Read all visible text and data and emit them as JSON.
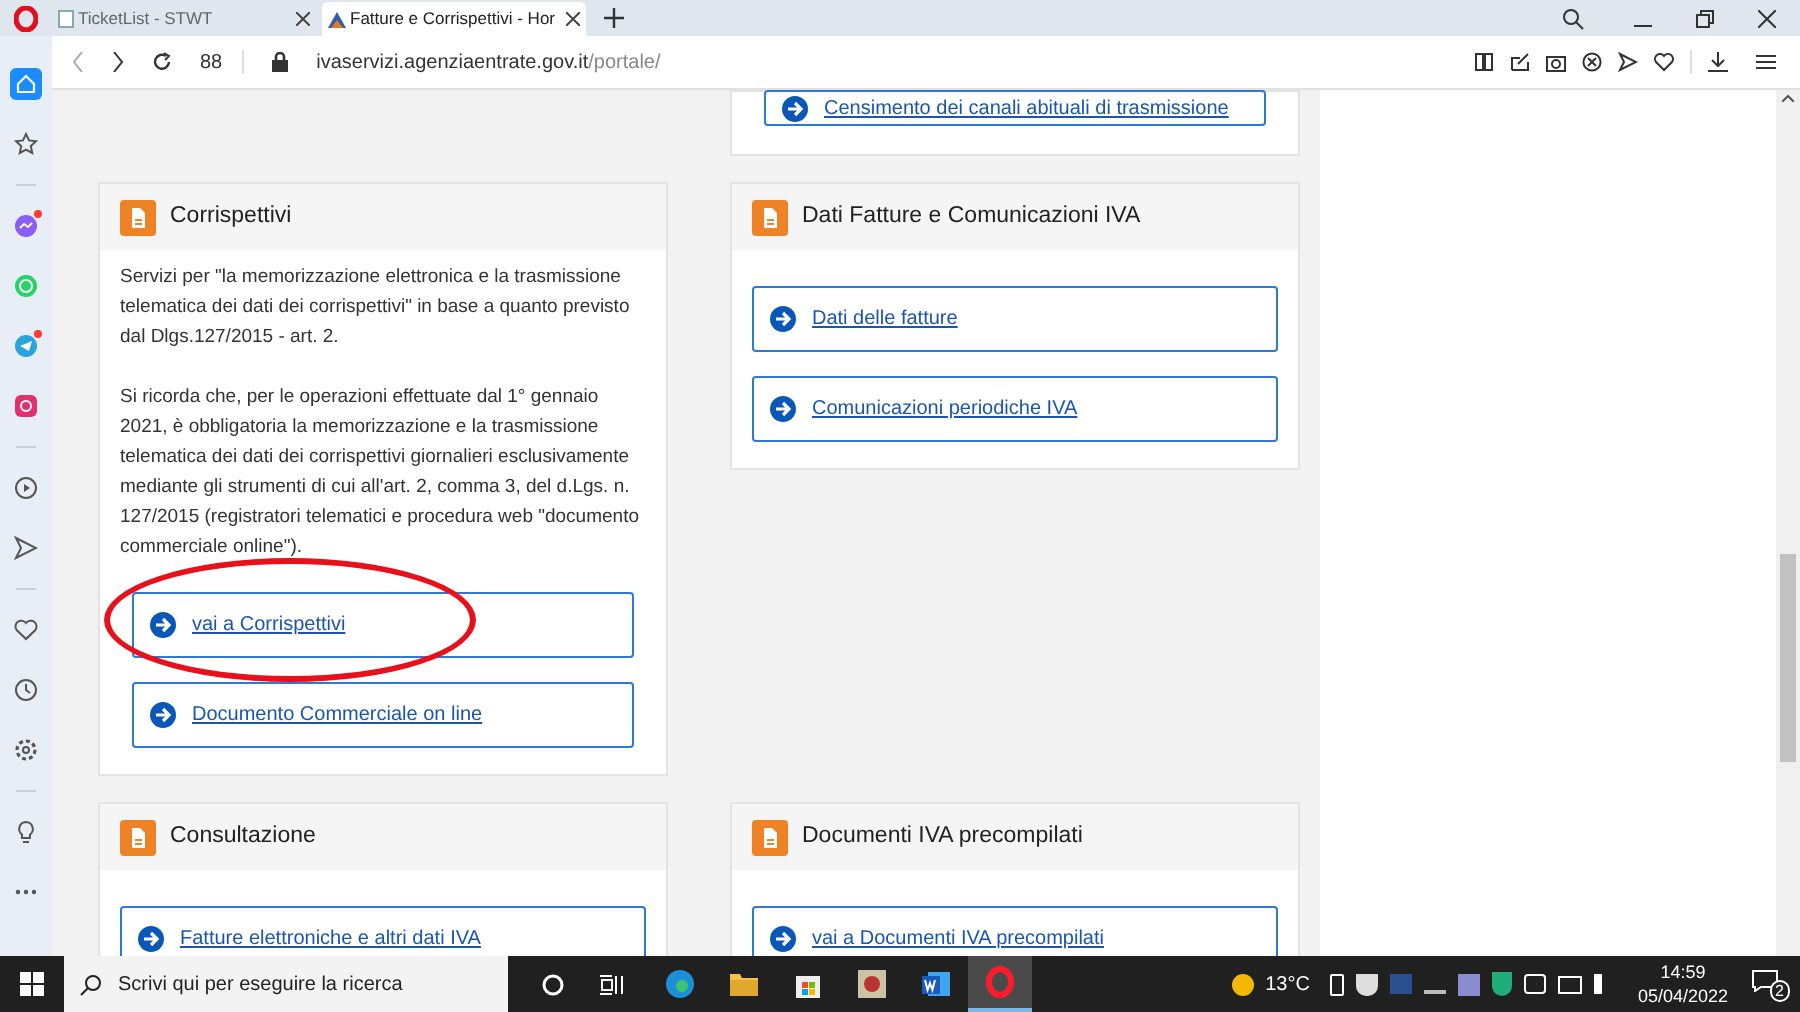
{
  "browser": {
    "tabs": [
      {
        "title": "TicketList - STWT",
        "selected": false
      },
      {
        "title": "Fatture e Corrispettivi - Hor",
        "selected": true
      }
    ],
    "speed_dial": "88",
    "url_domain": "ivaservizi.agenziaentrate.gov.it",
    "url_path": "/portale/"
  },
  "sidebar": {
    "items": [
      {
        "kind": "home",
        "selected": true,
        "badge": false
      },
      {
        "kind": "star",
        "selected": false,
        "badge": false
      },
      {
        "kind": "messenger",
        "selected": false,
        "badge": true
      },
      {
        "kind": "whatsapp",
        "selected": false,
        "badge": false
      },
      {
        "kind": "telegram",
        "selected": false,
        "badge": true
      },
      {
        "kind": "instagram",
        "selected": false,
        "badge": false
      },
      {
        "kind": "player",
        "selected": false,
        "badge": false
      },
      {
        "kind": "send",
        "selected": false,
        "badge": false
      },
      {
        "kind": "heart",
        "selected": false,
        "badge": false
      },
      {
        "kind": "clock",
        "selected": false,
        "badge": false
      },
      {
        "kind": "settings",
        "selected": false,
        "badge": false
      },
      {
        "kind": "bulb",
        "selected": false,
        "badge": false
      },
      {
        "kind": "more",
        "selected": false,
        "badge": false
      }
    ]
  },
  "cards": [
    {
      "links": [
        {
          "label": "Censimento dei canali abituali di trasmissione",
          "circled": false
        }
      ]
    },
    {
      "title": "Corrispettivi",
      "paragraphs": [
        "Servizi per \"la memorizzazione elettronica e la trasmissione telematica dei dati dei corrispettivi\" in base a quanto previsto dal Dlgs.127/2015 - art. 2.",
        "Si ricorda che, per le operazioni effettuate dal 1° gennaio 2021, è obbligatoria la memorizzazione e la trasmissione telematica dei dati dei corrispettivi giornalieri esclusivamente mediante gli strumenti di cui all'art. 2, comma 3, del d.Lgs. n. 127/2015 (registratori telematici e procedura web \"documento commerciale online\")."
      ],
      "links": [
        {
          "label": "vai a Corrispettivi",
          "circled": true
        },
        {
          "label": "Documento Commerciale on line",
          "circled": false
        }
      ]
    },
    {
      "title": "Dati Fatture e Comunicazioni IVA",
      "links": [
        {
          "label": "Dati delle fatture",
          "circled": false
        },
        {
          "label": "Comunicazioni periodiche IVA",
          "circled": false
        }
      ]
    },
    {
      "title": "Consultazione",
      "links": [
        {
          "label": "Fatture elettroniche e altri dati IVA",
          "circled": false
        }
      ]
    },
    {
      "title": "Documenti IVA precompilati",
      "links": [
        {
          "label": "vai a Documenti IVA precompilati",
          "circled": false
        }
      ]
    }
  ],
  "taskbar": {
    "search_placeholder": "Scrivi qui per eseguire la ricerca",
    "apps": [
      {
        "kind": "edge",
        "active": false
      },
      {
        "kind": "folder",
        "active": false
      },
      {
        "kind": "store",
        "active": false
      },
      {
        "kind": "app",
        "active": false
      },
      {
        "kind": "word",
        "active": false
      },
      {
        "kind": "opera",
        "active": true
      }
    ],
    "temperature": "13°C",
    "time": "14:59",
    "date": "05/04/2022",
    "notifications": "2"
  }
}
